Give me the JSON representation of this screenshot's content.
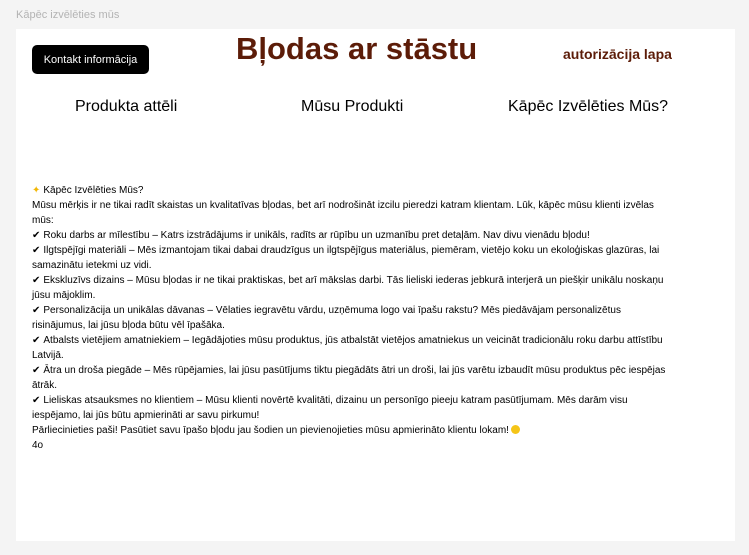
{
  "page_label": "Kāpēc izvēlēties mūs",
  "colors": {
    "brand": "#5c1c08",
    "button_bg": "#000000",
    "frame_bg": "#ffffff",
    "canvas_bg": "#f4f4f4"
  },
  "header": {
    "contact_button": "Kontakt informācija",
    "brand_title": "Bļodas ar stāstu",
    "auth_link": "autorizācija lapa"
  },
  "nav": {
    "items": [
      "Produkta attēli",
      "Mūsu Produkti",
      "Kāpēc Izvēlēties Mūs?"
    ]
  },
  "content": {
    "heading_icon": "sparkle-icon",
    "heading": "Kāpēc Izvēlēties Mūs?",
    "intro": "Mūsu mērķis ir ne tikai radīt skaistas un kvalitatīvas bļodas, bet arī nodrošināt izcilu pieredzi katram klientam. Lūk, kāpēc mūsu klienti izvēlas mūs:",
    "check_glyph": "✔",
    "points": [
      "Roku darbs ar mīlestību – Katrs izstrādājums ir unikāls, radīts ar rūpību un uzmanību pret detaļām. Nav divu vienādu bļodu!",
      "Ilgtspējīgi materiāli – Mēs izmantojam tikai dabai draudzīgus un ilgtspējīgus materiālus, piemēram, vietējo koku un ekoloģiskas glazūras, lai samazinātu ietekmi uz vidi.",
      "Ekskluzīvs dizains – Mūsu bļodas ir ne tikai praktiskas, bet arī mākslas darbi. Tās lieliski iederas jebkurā interjerā un piešķir unikālu noskaņu jūsu mājoklim.",
      "Personalizācija un unikālas dāvanas – Vēlaties iegravētu vārdu, uzņēmuma logo vai īpašu rakstu? Mēs piedāvājam personalizētus risinājumus, lai jūsu bļoda būtu vēl īpašāka.",
      "Atbalsts vietējiem amatniekiem – Iegādājoties mūsu produktus, jūs atbalstāt vietējos amatniekus un veicināt tradicionālu roku darbu attīstību Latvijā.",
      "Ātra un droša piegāde – Mēs rūpējamies, lai jūsu pasūtījums tiktu piegādāts ātri un droši, lai jūs varētu izbaudīt mūsu produktus pēc iespējas ātrāk.",
      "Lieliskas atsauksmes no klientiem – Mūsu klienti novērtē kvalitāti, dizainu un personīgo pieeju katram pasūtījumam. Mēs darām visu iespējamo, lai jūs būtu apmierināti ar savu pirkumu!"
    ],
    "closing": "Pārliecinieties paši! Pasūtiet savu īpašo bļodu jau šodien un pievienojieties mūsu apmierināto klientu lokam!",
    "closing_icon": "smile-icon",
    "footer_text": "4o"
  }
}
